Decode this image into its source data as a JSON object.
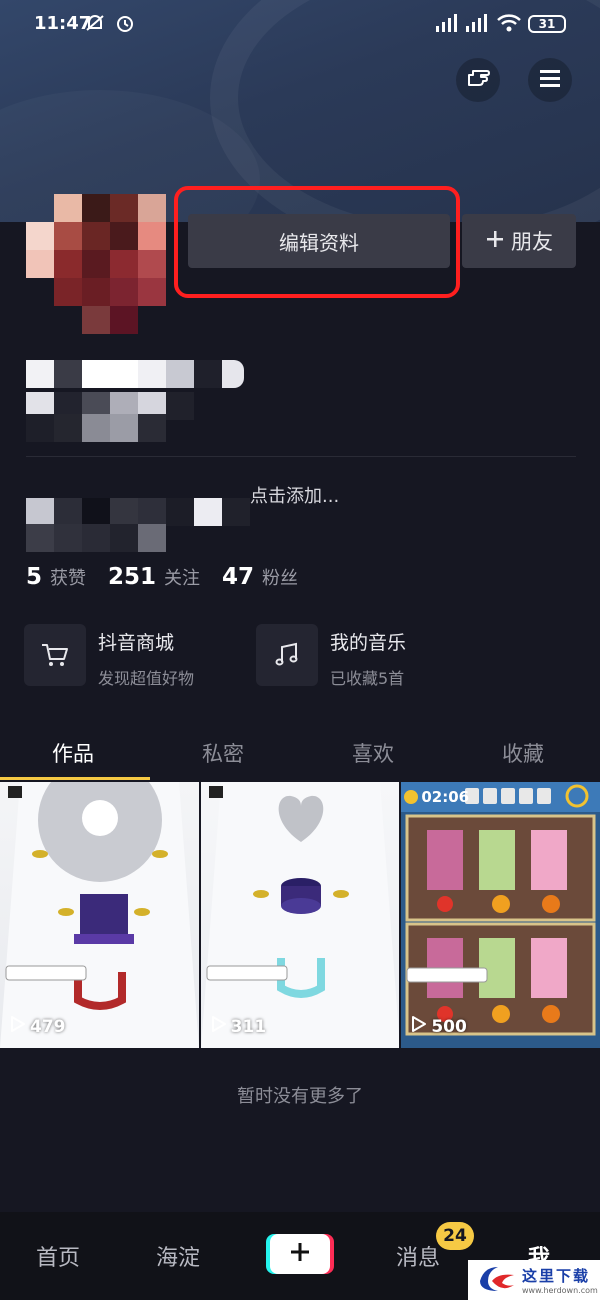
{
  "status_bar": {
    "time": "11:47",
    "battery": "31"
  },
  "profile": {
    "edit_label": "编辑资料",
    "friend_label": "朋友",
    "add_hint": "点击添加..."
  },
  "stats": [
    {
      "num": "5",
      "label": "获赞"
    },
    {
      "num": "251",
      "label": "关注"
    },
    {
      "num": "47",
      "label": "粉丝"
    }
  ],
  "features": [
    {
      "title": "抖音商城",
      "sub": "发现超值好物"
    },
    {
      "title": "我的音乐",
      "sub": "已收藏5首"
    }
  ],
  "tabs": [
    "作品",
    "私密",
    "喜欢",
    "收藏"
  ],
  "videos": [
    {
      "views": "479"
    },
    {
      "views": "311"
    },
    {
      "views": "500",
      "timer": "02:06"
    }
  ],
  "end_hint": "暂时没有更多了",
  "bottom_nav": {
    "home": "首页",
    "local": "海淀",
    "messages": "消息",
    "me": "我",
    "badge": "24"
  },
  "watermark": {
    "text": "这里下载",
    "url": "www.herdown.com"
  },
  "colors": {
    "accent": "#f6c944",
    "highlight": "#ff1f1f",
    "background": "#161722"
  }
}
